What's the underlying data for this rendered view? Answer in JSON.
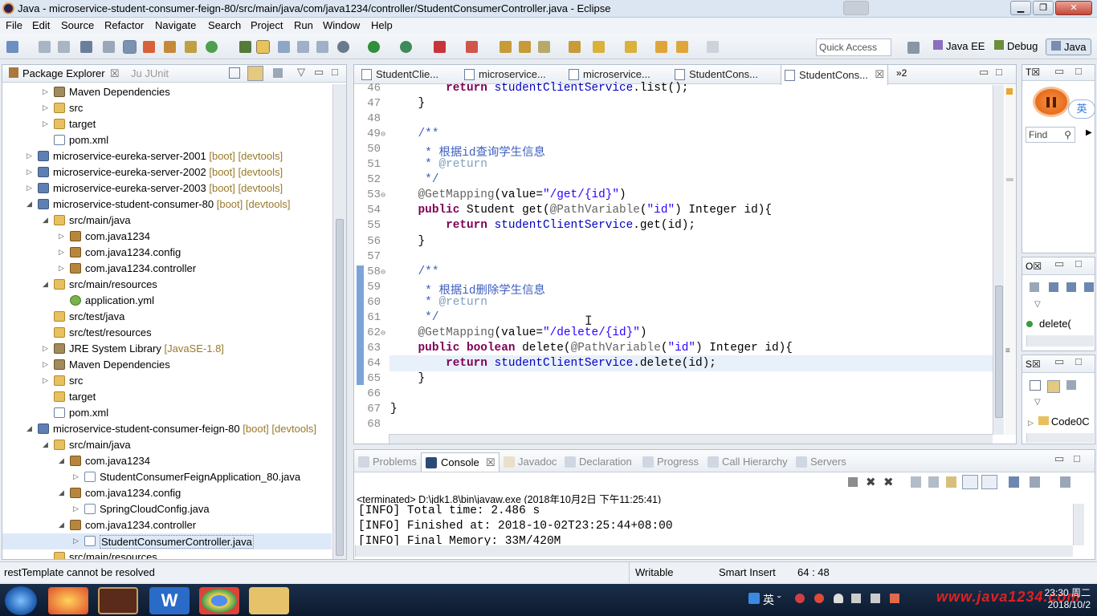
{
  "window": {
    "title": "Java - microservice-student-consumer-feign-80/src/main/java/com/java1234/controller/StudentConsumerController.java - Eclipse"
  },
  "menu": [
    "File",
    "Edit",
    "Source",
    "Refactor",
    "Navigate",
    "Search",
    "Project",
    "Run",
    "Window",
    "Help"
  ],
  "toolbar": {
    "quick_access_placeholder": "Quick Access",
    "perspectives": [
      "Java EE",
      "Debug",
      "Java"
    ]
  },
  "package_explorer": {
    "tabs": [
      "Package Explorer",
      "JUnit"
    ],
    "rows": [
      {
        "text": "Maven Dependencies",
        "decor": "",
        "icon": "lib-icon",
        "level": 2,
        "twisty": "▷"
      },
      {
        "text": "src",
        "decor": "",
        "icon": "folder-icon",
        "level": 2,
        "twisty": "▷"
      },
      {
        "text": "target",
        "decor": "",
        "icon": "folder-icon",
        "level": 2,
        "twisty": "▷"
      },
      {
        "text": "pom.xml",
        "decor": "",
        "icon": "xml-file-icon",
        "level": 2,
        "twisty": ""
      },
      {
        "text": "microservice-eureka-server-2001",
        "decor": "[boot] [devtools]",
        "icon": "project-icon",
        "level": 1,
        "twisty": "▷"
      },
      {
        "text": "microservice-eureka-server-2002",
        "decor": "[boot] [devtools]",
        "icon": "project-icon",
        "level": 1,
        "twisty": "▷"
      },
      {
        "text": "microservice-eureka-server-2003",
        "decor": "[boot] [devtools]",
        "icon": "project-icon",
        "level": 1,
        "twisty": "▷"
      },
      {
        "text": "microservice-student-consumer-80",
        "decor": "[boot] [devtools]",
        "icon": "project-icon",
        "level": 1,
        "twisty": "◢"
      },
      {
        "text": "src/main/java",
        "decor": "",
        "icon": "folder-icon",
        "level": 2,
        "twisty": "◢"
      },
      {
        "text": "com.java1234",
        "decor": "",
        "icon": "package-icon",
        "level": 3,
        "twisty": "▷"
      },
      {
        "text": "com.java1234.config",
        "decor": "",
        "icon": "package-icon",
        "level": 3,
        "twisty": "▷"
      },
      {
        "text": "com.java1234.controller",
        "decor": "",
        "icon": "package-icon",
        "level": 3,
        "twisty": "▷"
      },
      {
        "text": "src/main/resources",
        "decor": "",
        "icon": "folder-icon",
        "level": 2,
        "twisty": "◢"
      },
      {
        "text": "application.yml",
        "decor": "",
        "icon": "yml-file-icon",
        "level": 3,
        "twisty": ""
      },
      {
        "text": "src/test/java",
        "decor": "",
        "icon": "folder-icon",
        "level": 2,
        "twisty": ""
      },
      {
        "text": "src/test/resources",
        "decor": "",
        "icon": "folder-icon",
        "level": 2,
        "twisty": ""
      },
      {
        "text": "JRE System Library",
        "decor": "[JavaSE-1.8]",
        "icon": "lib-icon",
        "level": 2,
        "twisty": "▷"
      },
      {
        "text": "Maven Dependencies",
        "decor": "",
        "icon": "lib-icon",
        "level": 2,
        "twisty": "▷"
      },
      {
        "text": "src",
        "decor": "",
        "icon": "folder-icon",
        "level": 2,
        "twisty": "▷"
      },
      {
        "text": "target",
        "decor": "",
        "icon": "folder-icon",
        "level": 2,
        "twisty": ""
      },
      {
        "text": "pom.xml",
        "decor": "",
        "icon": "xml-file-icon",
        "level": 2,
        "twisty": ""
      },
      {
        "text": "microservice-student-consumer-feign-80",
        "decor": "[boot] [devtools]",
        "icon": "project-icon",
        "level": 1,
        "twisty": "◢"
      },
      {
        "text": "src/main/java",
        "decor": "",
        "icon": "folder-icon",
        "level": 2,
        "twisty": "◢"
      },
      {
        "text": "com.java1234",
        "decor": "",
        "icon": "package-icon",
        "level": 3,
        "twisty": "◢"
      },
      {
        "text": "StudentConsumerFeignApplication_80.java",
        "decor": "",
        "icon": "java-file-icon",
        "level": 4,
        "twisty": "▷"
      },
      {
        "text": "com.java1234.config",
        "decor": "",
        "icon": "package-icon",
        "level": 3,
        "twisty": "◢"
      },
      {
        "text": "SpringCloudConfig.java",
        "decor": "",
        "icon": "java-file-icon",
        "level": 4,
        "twisty": "▷"
      },
      {
        "text": "com.java1234.controller",
        "decor": "",
        "icon": "package-icon",
        "level": 3,
        "twisty": "◢"
      },
      {
        "text": "StudentConsumerController.java",
        "decor": "",
        "icon": "java-file-icon",
        "level": 4,
        "twisty": "▷",
        "selected": true
      },
      {
        "text": "src/main/resources",
        "decor": "",
        "icon": "folder-icon",
        "level": 2,
        "twisty": ""
      }
    ]
  },
  "editor": {
    "tabs": [
      "StudentClie...",
      "microservice...",
      "microservice...",
      "StudentCons...",
      "StudentCons..."
    ],
    "overflow": "»2",
    "lines": [
      {
        "n": "46",
        "html": "        <span class='kw'>return</span> <span class='mt'>studentClientService</span>.list();"
      },
      {
        "n": "47",
        "html": "    }"
      },
      {
        "n": "48",
        "html": ""
      },
      {
        "n": "49⊖",
        "html": "    <span class='cm'>/**</span>"
      },
      {
        "n": "50",
        "html": "<span class='cm'>     * 根据id查询学生信息</span>"
      },
      {
        "n": "51",
        "html": "<span class='cm'>     * </span><span class='ann'>@return</span>"
      },
      {
        "n": "52",
        "html": "<span class='cm'>     */</span>"
      },
      {
        "n": "53⊖",
        "html": "    <span class='an'>@GetMapping</span>(value=<span class='st'>\"/get/{id}\"</span>)"
      },
      {
        "n": "54",
        "html": "    <span class='kw'>public</span> Student get(<span class='an'>@PathVariable</span>(<span class='st'>\"id\"</span>) Integer id){"
      },
      {
        "n": "55",
        "html": "        <span class='kw'>return</span> <span class='mt'>studentClientService</span>.get(id);"
      },
      {
        "n": "56",
        "html": "    }"
      },
      {
        "n": "57",
        "html": ""
      },
      {
        "n": "58⊖",
        "html": "    <span class='cm'>/**</span>"
      },
      {
        "n": "59",
        "html": "<span class='cm'>     * 根据id删除学生信息</span>"
      },
      {
        "n": "60",
        "html": "<span class='cm'>     * </span><span class='ann'>@return</span>"
      },
      {
        "n": "61",
        "html": "<span class='cm'>     */</span>"
      },
      {
        "n": "62⊖",
        "html": "    <span class='an'>@GetMapping</span>(value=<span class='st'>\"/delete/{id}\"</span>)"
      },
      {
        "n": "63",
        "html": "    <span class='kw'>public</span> <span class='kw'>boolean</span> delete(<span class='an'>@PathVariable</span>(<span class='st'>\"id\"</span>) Integer id){"
      },
      {
        "n": "64",
        "html": "        <span class='kw'>return</span> <span class='mt'>studentClientService</span>.delete(id);"
      },
      {
        "n": "65",
        "html": "    }"
      },
      {
        "n": "66",
        "html": ""
      },
      {
        "n": "67",
        "html": "}"
      },
      {
        "n": "68",
        "html": ""
      }
    ]
  },
  "right_views": {
    "find_label": "Find",
    "outline_item": "delete(",
    "bottom_item": "Code0C",
    "ime_label": "英"
  },
  "console": {
    "tabs": [
      "Problems",
      "Console",
      "Javadoc",
      "Declaration",
      "Progress",
      "Call Hierarchy",
      "Servers"
    ],
    "header": "<terminated> D:\\jdk1.8\\bin\\javaw.exe (2018年10月2日 下午11:25:41)",
    "lines": [
      "[INFO] Total time: 2.486 s",
      "[INFO] Finished at: 2018-10-02T23:25:44+08:00",
      "[INFO] Final Memory: 33M/420M"
    ]
  },
  "status": {
    "message": "restTemplate cannot be resolved",
    "writable": "Writable",
    "insert_mode": "Smart Insert",
    "position": "64 : 48"
  },
  "taskbar": {
    "time": "23:30 周二",
    "date": "2018/10/2",
    "watermark": "www.java1234.com",
    "ime": "英"
  }
}
